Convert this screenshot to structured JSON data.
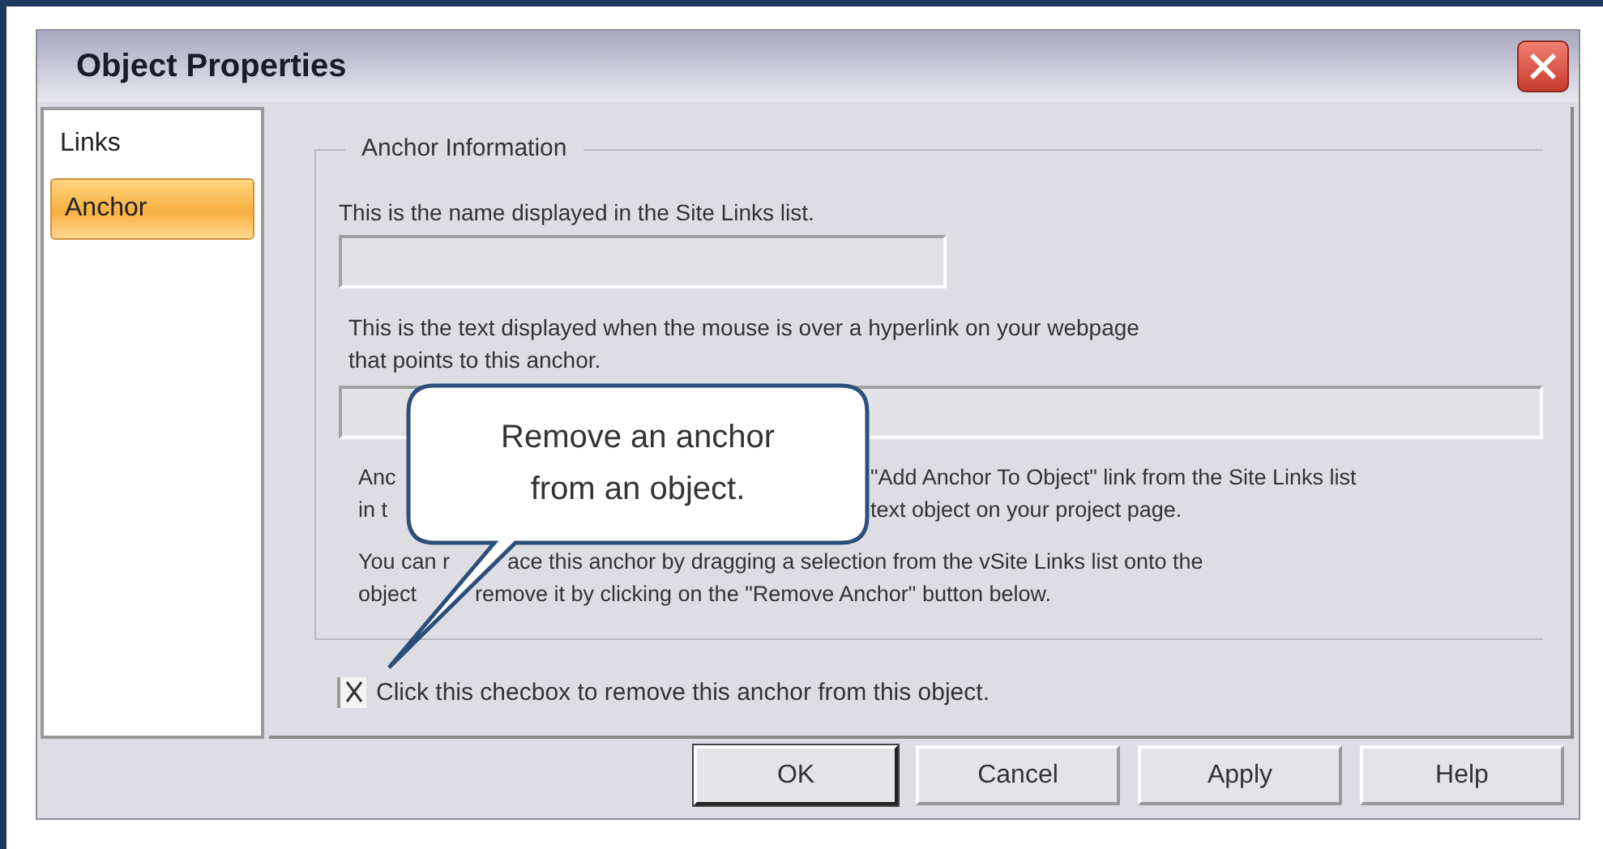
{
  "window": {
    "title": "Object Properties"
  },
  "sidebar": {
    "items": [
      {
        "label": "Links",
        "selected": false
      },
      {
        "label": "Anchor",
        "selected": true
      }
    ]
  },
  "group": {
    "title": "Anchor Information",
    "name_hint": "This is the name displayed in the Site Links list.",
    "tooltip_hint": [
      "This is the text displayed when the mouse is over a hyperlink on your webpage",
      "that points to this anchor."
    ],
    "paragraphs": [
      [
        [
          "Anc",
          "\"Add Anchor To Object\" link from the Site Links list"
        ],
        [
          "in t",
          "text object on your project page."
        ]
      ],
      [
        [
          "You can r",
          "ace this anchor by dragging a selection from the vSite Links list onto the"
        ],
        [
          "object",
          "remove it by clicking on the \"Remove Anchor\" button below."
        ]
      ]
    ]
  },
  "checkbox": {
    "label": "Click this checbox to remove this anchor from this object.",
    "checked": true
  },
  "buttons": [
    {
      "label": "OK",
      "default": true
    },
    {
      "label": "Cancel",
      "default": false
    },
    {
      "label": "Apply",
      "default": false
    },
    {
      "label": "Help",
      "default": false
    }
  ],
  "callout": {
    "lines": [
      "Remove an anchor",
      "from an object."
    ]
  }
}
